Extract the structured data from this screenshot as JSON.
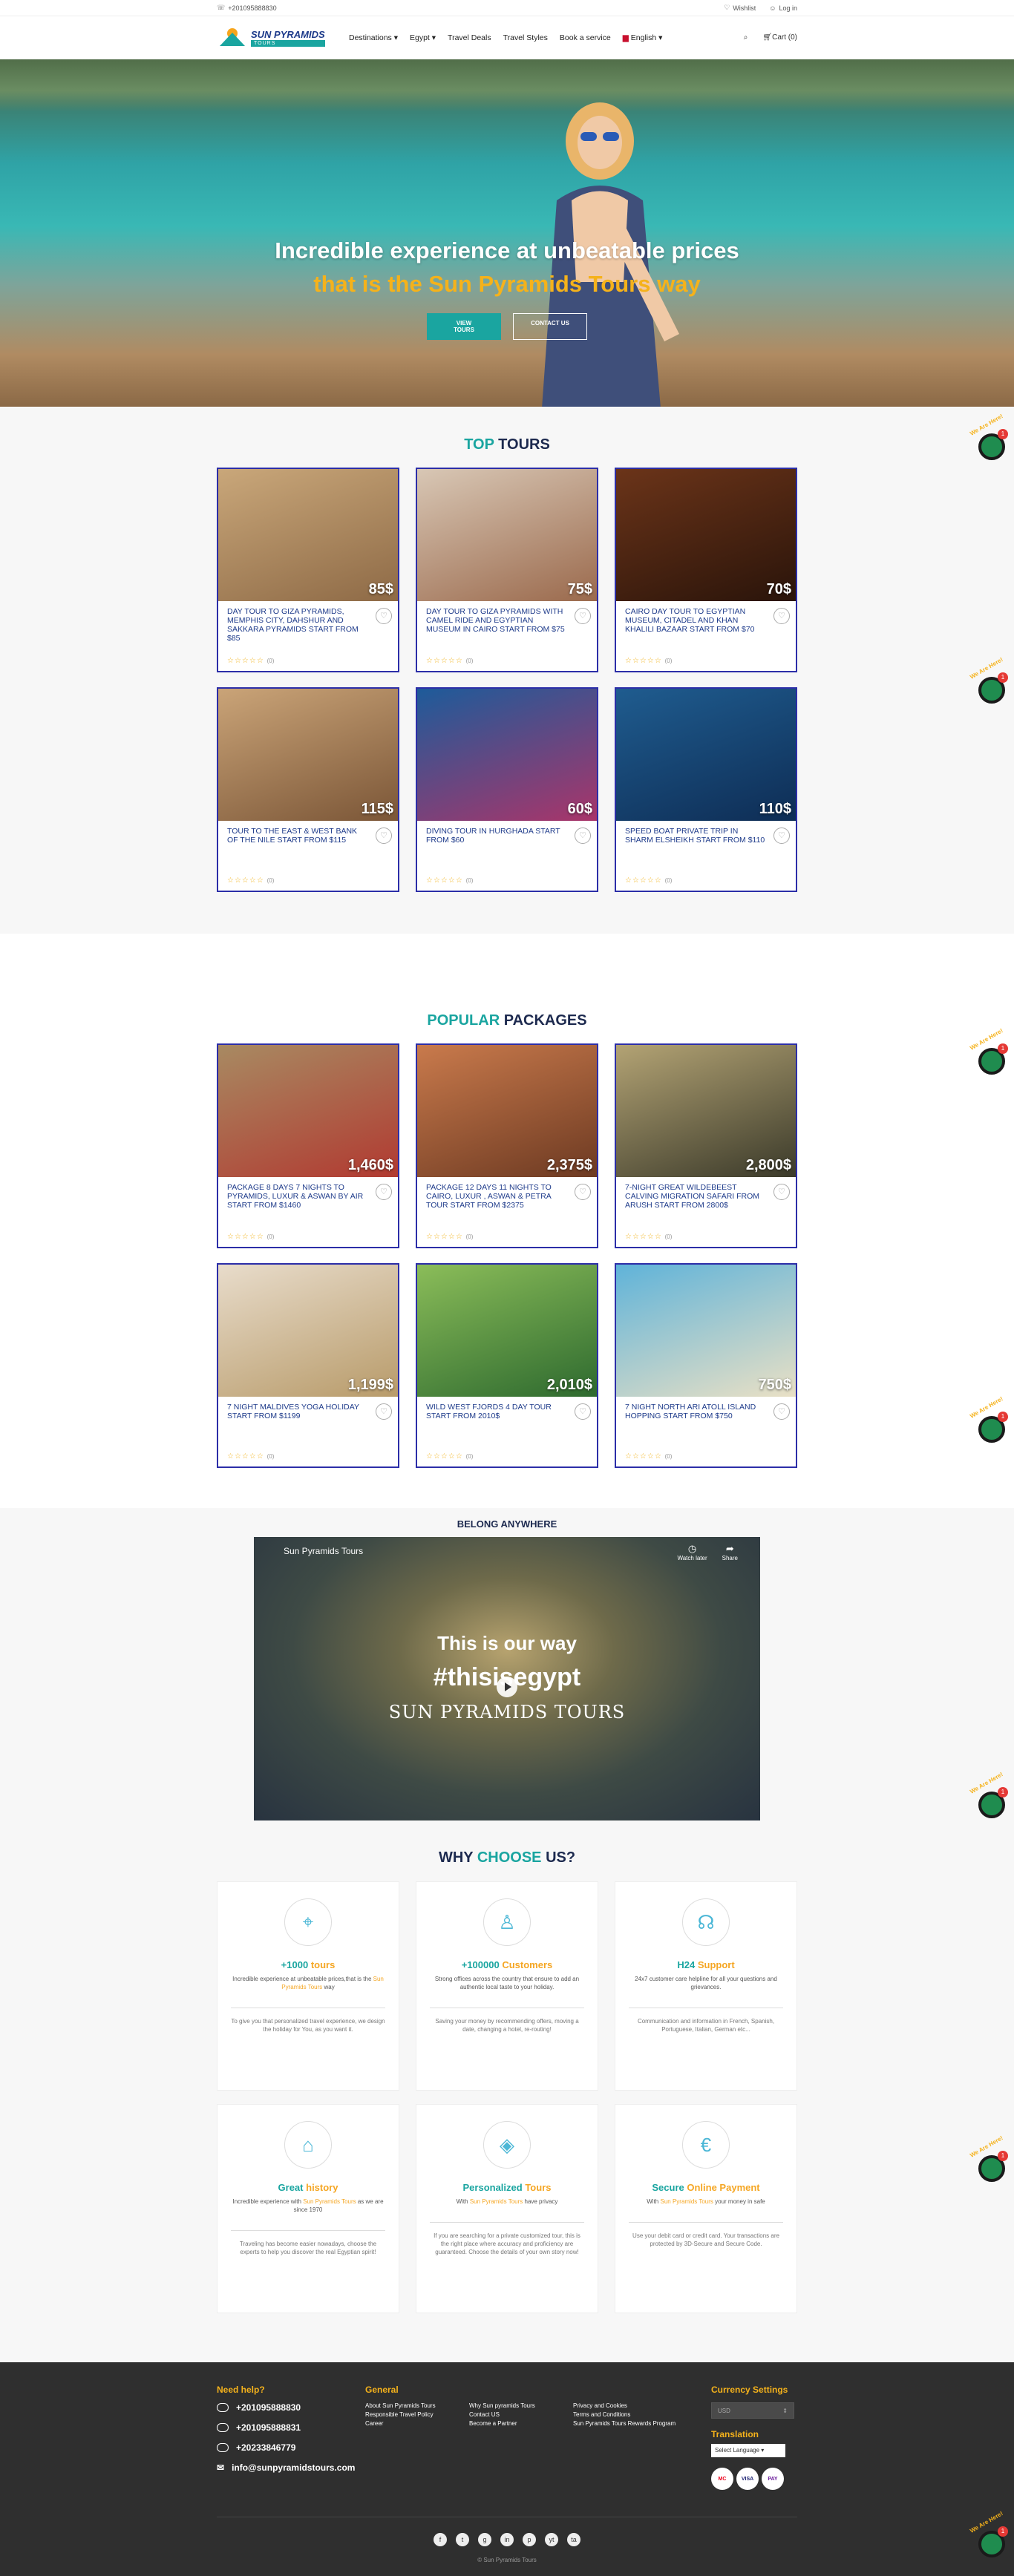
{
  "topbar": {
    "phone": "+201095888830",
    "wishlist": "Wishlist",
    "login": "Log in"
  },
  "header": {
    "logo_line1": "SUN PYRAMIDS",
    "logo_line2": "TOURS",
    "nav": [
      "Destinations",
      "Egypt",
      "Travel Deals",
      "Travel Styles",
      "Book a service",
      "English"
    ],
    "cart": "Cart (0)"
  },
  "hero": {
    "line1": "Incredible experience at unbeatable prices",
    "line2": "that is the Sun Pyramids Tours way",
    "btn_primary": "VIEW TOURS",
    "btn_secondary": "CONTACT US"
  },
  "top_tours": {
    "title_hl": "TOP",
    "title_rest": "TOURS",
    "cards": [
      {
        "title": "DAY TOUR TO GIZA PYRAMIDS, MEMPHIS CITY, DAHSHUR AND SAKKARA PYRAMIDS START FROM $85",
        "price": "85$",
        "reviews": "(0)",
        "rating": 0,
        "colors": [
          "#c9a77a",
          "#8e6a46"
        ]
      },
      {
        "title": "DAY TOUR TO GIZA PYRAMIDS WITH CAMEL RIDE AND EGYPTIAN MUSEUM IN CAIRO START FROM $75",
        "price": "75$",
        "reviews": "(0)",
        "rating": 0,
        "colors": [
          "#d8c7b5",
          "#9b6a4d"
        ]
      },
      {
        "title": "CAIRO DAY TOUR TO EGYPTIAN MUSEUM, CITADEL AND KHAN KHALILI BAZAAR START FROM $70",
        "price": "70$",
        "reviews": "(0)",
        "rating": 0,
        "colors": [
          "#6b3419",
          "#2a140a"
        ]
      },
      {
        "title": "TOUR TO THE EAST & WEST BANK OF THE NILE START FROM $115",
        "price": "115$",
        "reviews": "(0)",
        "rating": 0,
        "colors": [
          "#caa478",
          "#7b5637"
        ]
      },
      {
        "title": "DIVING TOUR IN HURGHADA START FROM $60",
        "price": "60$",
        "reviews": "(0)",
        "rating": 0,
        "colors": [
          "#1d5b9a",
          "#a9356a"
        ]
      },
      {
        "title": "SPEED BOAT PRIVATE TRIP IN SHARM ELSHEIKH START FROM $110",
        "price": "110$",
        "reviews": "(0)",
        "rating": 0,
        "colors": [
          "#1f5c8f",
          "#0e2d55"
        ]
      }
    ]
  },
  "popular": {
    "title_hl": "POPULAR",
    "title_rest": "PACKAGES",
    "cards": [
      {
        "title": "PACKAGE 8 DAYS 7 NIGHTS TO PYRAMIDS, LUXUR & ASWAN BY AIR START FROM $1460",
        "price": "1,460$",
        "reviews": "(0)",
        "rating": 0,
        "colors": [
          "#a88a62",
          "#b13a31"
        ]
      },
      {
        "title": "PACKAGE 12 DAYS 11 NIGHTS TO CAIRO, LUXUR , ASWAN & PETRA TOUR START FROM $2375",
        "price": "2,375$",
        "reviews": "(0)",
        "rating": 0,
        "colors": [
          "#c97a4c",
          "#6d3a22"
        ]
      },
      {
        "title": "7-NIGHT GREAT WILDEBEEST CALVING MIGRATION SAFARI FROM ARUSH START FROM 2800$",
        "price": "2,800$",
        "reviews": "(0)",
        "rating": 0,
        "colors": [
          "#b3a374",
          "#3b3a2a"
        ]
      },
      {
        "title": "7 NIGHT MALDIVES YOGA HOLIDAY START FROM $1199",
        "price": "1,199$",
        "reviews": "(0)",
        "rating": 0,
        "colors": [
          "#e8dccb",
          "#b89b6a"
        ]
      },
      {
        "title": "WILD WEST FJORDS 4 DAY TOUR START FROM 2010$",
        "price": "2,010$",
        "reviews": "(0)",
        "rating": 0,
        "colors": [
          "#8bbd59",
          "#2e6a2f"
        ]
      },
      {
        "title": "7 NIGHT NORTH ARI ATOLL ISLAND HOPPING START FROM $750",
        "price": "750$",
        "reviews": "(0)",
        "rating": 0,
        "colors": [
          "#5fb3d9",
          "#e9e0c5"
        ]
      }
    ]
  },
  "belong": {
    "title": "BELONG ANYWHERE",
    "video_channel": "Sun Pyramids Tours",
    "watch_later": "Watch later",
    "share": "Share",
    "line1": "This is our way",
    "line2": "#thisisegypt",
    "line3": "SUN PYRAMIDS TOURS"
  },
  "why": {
    "title_a": "WHY",
    "title_hl": "CHOOSE",
    "title_b": "US?",
    "features": [
      {
        "icon": "map-pin-icon",
        "glyph": "⌖",
        "title_a": "+1000",
        "title_b": "tours",
        "desc_a": "Incredible experience at unbeatable prices,that is the ",
        "desc_hl": "Sun Pyramids Tours",
        "desc_b": " way",
        "note": "To give you that personalized travel experience, we design the holiday for You, as you want it."
      },
      {
        "icon": "hiker-icon",
        "glyph": "♙",
        "title_a": "+100000",
        "title_b": "Customers",
        "desc_a": "Strong offices across the country that ensure to add an authentic local taste to your holiday.",
        "desc_hl": "",
        "desc_b": "",
        "note": "Saving your money by recommending offers, moving a date, changing a hotel, re-routing!"
      },
      {
        "icon": "support-agent-icon",
        "glyph": "☊",
        "title_a": "H24",
        "title_b": "Support",
        "desc_a": "24x7 customer care helpline for all your questions and grievances.",
        "desc_hl": "",
        "desc_b": "",
        "note": "Communication and information in French, Spanish, Portuguese, Italian, German etc..."
      },
      {
        "icon": "temple-icon",
        "glyph": "⌂",
        "title_a": "Great",
        "title_b": "history",
        "desc_a": "Incredible experience with ",
        "desc_hl": "Sun Pyramids Tours",
        "desc_b": " as we are since 1970",
        "note": "Traveling has become easier nowadays, choose the experts to help you discover the real Egyptian spirit!"
      },
      {
        "icon": "map-location-icon",
        "glyph": "◈",
        "title_a": "Personalized",
        "title_b": "Tours",
        "desc_a": "With ",
        "desc_hl": "Sun Pyramids Tours",
        "desc_b": " have privacy",
        "note": "If you are searching for a private customized tour, this is the right place where accuracy and proficiency are guaranteed. Choose the details of your own story now!"
      },
      {
        "icon": "secure-payment-icon",
        "glyph": "€",
        "title_a": "Secure",
        "title_b": "Online Payment",
        "desc_a": "With ",
        "desc_hl": "Sun Pyramids Tours",
        "desc_b": " your money in safe",
        "note": "Use your debit card or credit card. Your transactions are protected by 3D-Secure and Secure Code."
      }
    ]
  },
  "footer": {
    "help_title": "Need help?",
    "phones": [
      "+201095888830",
      "+201095888831",
      "+20233846779"
    ],
    "email": "info@sunpyramidstours.com",
    "general_title": "General",
    "links": [
      "About Sun Pyramids Tours",
      "Why Sun pyramids Tours",
      "Privacy and Cookies",
      "Responsible Travel Policy",
      "Contact US",
      "Terms and Conditions",
      "Career",
      "Become a Partner",
      "Sun Pyramids Tours Rewards Program"
    ],
    "currency_title": "Currency Settings",
    "currency_value": "USD",
    "translation_title": "Translation",
    "translation_value": "Select Language",
    "payments": [
      "MC",
      "VISA",
      "PAY"
    ],
    "social": [
      "f",
      "t",
      "g",
      "in",
      "p",
      "yt",
      "ta"
    ],
    "copyright": "© Sun Pyramids Tours"
  },
  "chat": {
    "label": "We Are Here!",
    "badge": "1"
  }
}
